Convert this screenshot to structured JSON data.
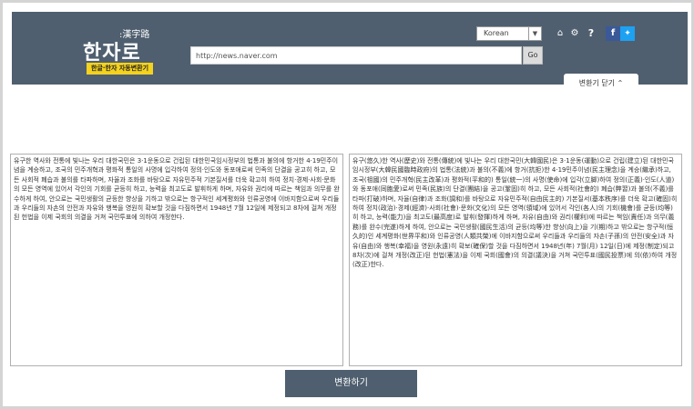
{
  "header": {
    "logo_hanja": ":漢字路",
    "logo_main": "한자로",
    "badge": "한글·한자 자동변환기",
    "url_value": "http://news.naver.com",
    "go_label": "Go",
    "language": "Korean",
    "close_label": "변환기 닫기 ⌃"
  },
  "icons": {
    "home": "home-icon",
    "gear": "gear-icon",
    "help": "help-icon",
    "facebook": "facebook-icon",
    "twitter": "twitter-icon"
  },
  "source_text": "유구한 역사와 전통에 빛나는 우리 대한국민은 3·1운동으로 건립된 대한민국임시정부의 법통과 불의에 항거한 4·19민주이념을 계승하고, 조국의 민주개혁과 평화적 통일의 사명에 입각하여 정의·인도와 동포애로써 민족의 단결을 공고히 하고, 모든 사회적 폐습과 불의를 타파하며, 자율과 조화를 바탕으로 자유민주적 기본질서를 더욱 확고히 하여 정치·경제·사회·문화의 모든 영역에 있어서 각인의 기회를 균등히 하고, 능력을 최고도로 발휘하게 하며, 자유와 권리에 따르는 책임과 의무를 완수하게 하여, 안으로는 국민생활의 균등한 향상을 기하고 밖으로는 항구적인 세계평화와 인류공영에 이바지함으로써 우리들과 우리들의 자손의 안전과 자유와 행복을 영원히 확보할 것을 다짐하면서 1948년 7월 12일에 제정되고 8차에 걸쳐 개정된 헌법을 이제 국회의 의결을 거쳐 국민투표에 의하여 개정한다.",
  "result_text": "유구(悠久)한 역사(歷史)와 전통(傳統)에 빛나는 우리 대한국민(大韓國民)은 3·1운동(運動)으로 건립(建立)된 대한민국임시정부(大韓民國臨時政府)의 법통(法統)과 불의(不義)에 항거(抗拒)한 4·19민주이념(民主理念)을 계승(繼承)하고, 조국(祖國)의 민주개혁(民主改革)과 평화적(平和的) 통일(統一)의 사명(使命)에 입각(立脚)하여 정의(正義)·인도(人道)와 동포애(同胞愛)로써 민족(民族)의 단결(團結)을 공고(鞏固)히 하고, 모든 사회적(社會的) 폐습(弊習)과 불의(不義)를 타파(打破)하며, 자율(自律)과 조화(調和)를 바탕으로 자유민주적(自由民主的) 기본질서(基本秩序)를 더욱 확고(確固)히 하여 정치(政治)·경제(經濟)·사회(社會)·문화(文化)의 모든 영역(領域)에 있어서 각인(各人)의 기회(機會)를 균등(均等)히 하고, 능력(能力)을 최고도(最高度)로 발휘(發揮)하게 하며, 자유(自由)와 권리(權利)에 따르는 책임(責任)과 의무(義務)를 완수(完遂)하게 하여, 안으로는 국민생활(國民生活)의 균등(均等)한 향상(向上)을 기(期)하고 밖으로는 항구적(恒久的)인 세계평화(世界平和)와 인류공영(人類共榮)에 이바지함으로써 우리들과 우리들의 자손(子孫)의 안전(安全)과 자유(自由)와 행복(幸福)을 영원(永遠)히 확보(確保)할 것을 다짐하면서 1948년(年) 7월(月) 12일(日)에 제정(制定)되고 8차(次)에 걸쳐 개정(改正)된 헌법(憲法)을 이제 국회(國會)의 의결(議決)을 거쳐 국민투표(國民投票)에 의(依)하여 개정(改正)한다.",
  "convert_label": "변환하기"
}
